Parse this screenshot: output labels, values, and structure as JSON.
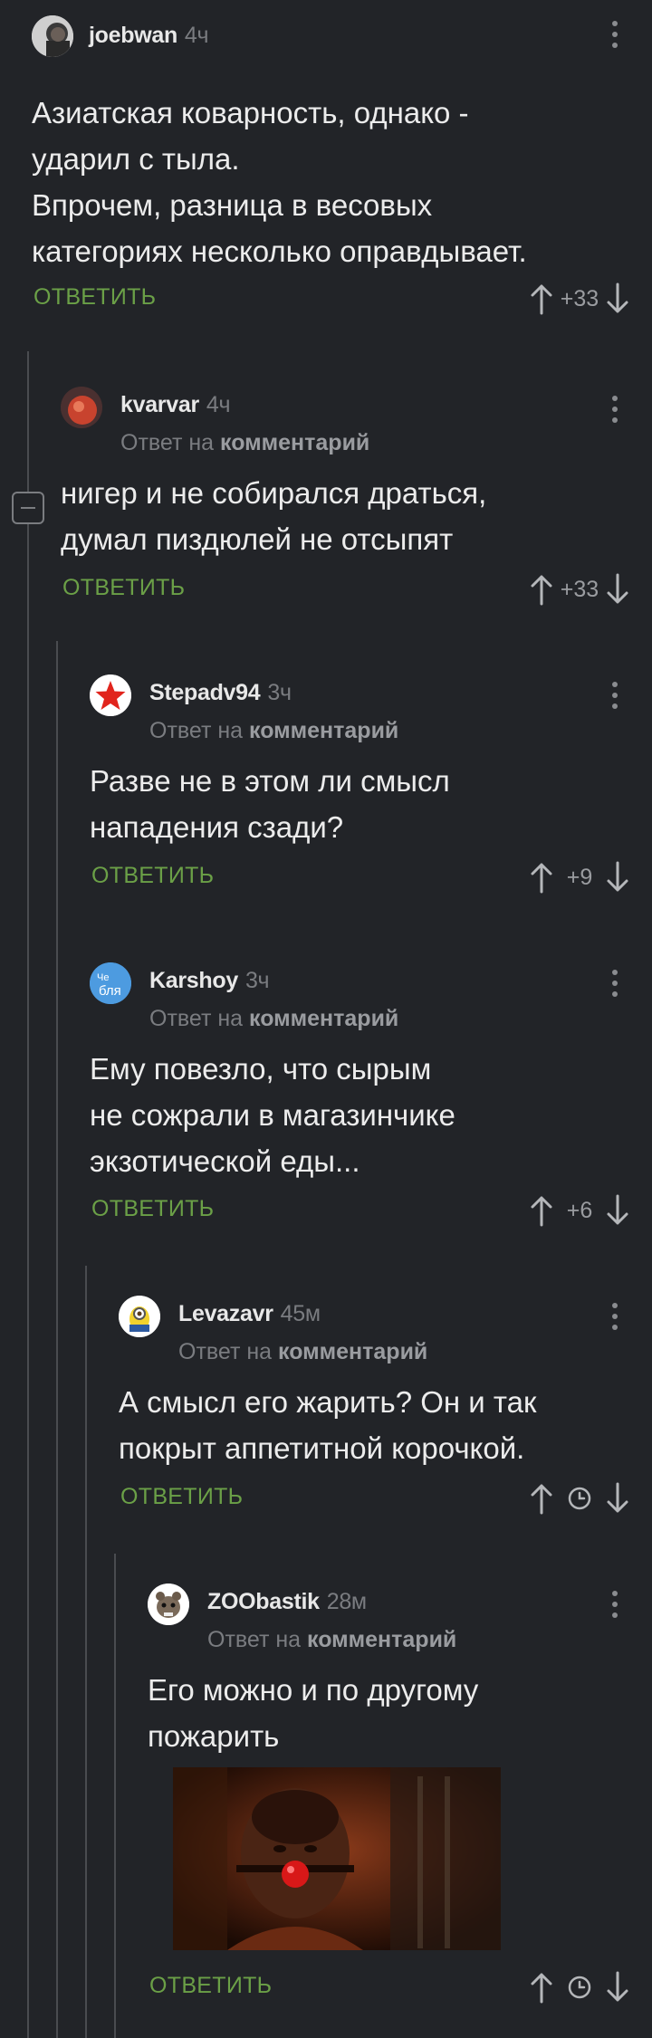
{
  "comments": [
    {
      "author": "joebwan",
      "time": "4ч",
      "reply_to": "",
      "text": "Азиатская коварность, однако -\nударил с тыла.\n Впрочем, разница в весовых\nкатегориях несколько оправдывает.",
      "reply_label": "ОТВЕТИТЬ",
      "rating": "+33"
    },
    {
      "author": "kvarvar",
      "time": "4ч",
      "reply_prefix": "Ответ на",
      "reply_to": "комментарий",
      "text": "нигер и не собирался драться,\nдумал пиздюлей не отсыпят",
      "reply_label": "ОТВЕТИТЬ",
      "rating": "+33"
    },
    {
      "author": "Stepadv94",
      "time": "3ч",
      "reply_prefix": "Ответ на",
      "reply_to": "комментарий",
      "text": "Разве не в этом ли смысл\nнападения сзади?",
      "reply_label": "ОТВЕТИТЬ",
      "rating": "+9"
    },
    {
      "author": "Karshoy",
      "time": "3ч",
      "reply_prefix": "Ответ на",
      "reply_to": "комментарий",
      "text": "Ему повезло, что сырым\nне сожрали в магазинчике\nэкзотической еды...",
      "reply_label": "ОТВЕТИТЬ",
      "rating": "+6"
    },
    {
      "author": "Levazavr",
      "time": "45м",
      "reply_prefix": "Ответ на",
      "reply_to": "комментарий",
      "text": "А смысл его жарить? Он и так\nпокрыт аппетитной корочкой.",
      "reply_label": "ОТВЕТИТЬ",
      "rating": ""
    },
    {
      "author": "ZOObastik",
      "time": "28м",
      "reply_prefix": "Ответ на",
      "reply_to": "комментарий",
      "text": "Его можно и по другому\nпожарить",
      "reply_label": "ОТВЕТИТЬ",
      "rating": ""
    }
  ],
  "karshoy_avatar_text": "Че\nбля",
  "colors": {
    "background": "#222428",
    "reply_green": "#6ba047",
    "muted": "#7a7c80",
    "thread_line": "#4a4c50"
  },
  "icons": [
    "vote-up-icon",
    "vote-down-icon",
    "clock-icon",
    "more-menu-icon",
    "collapse-thread-icon"
  ]
}
